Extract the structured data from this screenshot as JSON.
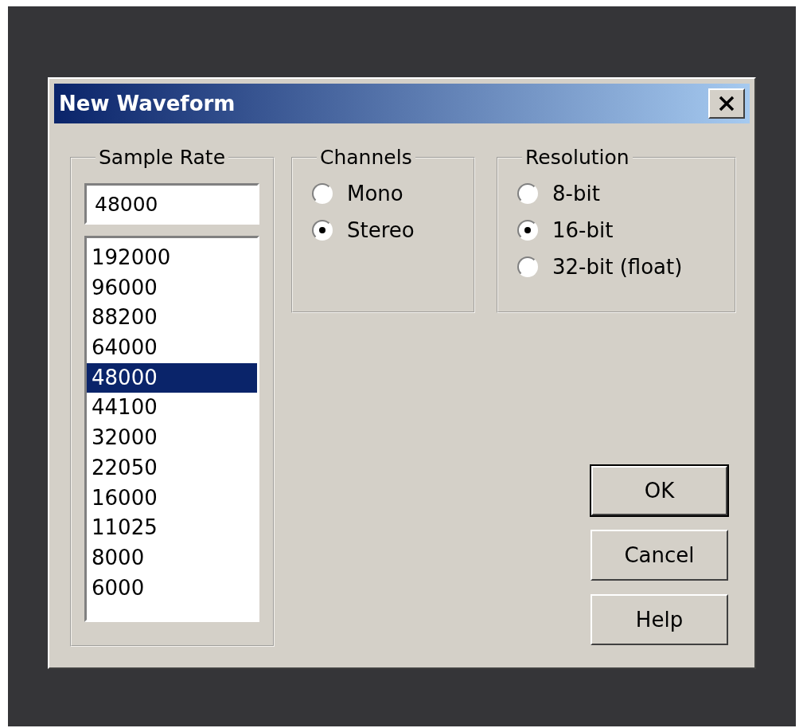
{
  "window": {
    "title": "New Waveform"
  },
  "sample_rate": {
    "label": "Sample Rate",
    "value": "48000",
    "options": [
      {
        "text": "192000",
        "selected": false
      },
      {
        "text": "96000",
        "selected": false
      },
      {
        "text": "88200",
        "selected": false
      },
      {
        "text": "64000",
        "selected": false
      },
      {
        "text": "48000",
        "selected": true
      },
      {
        "text": "44100",
        "selected": false
      },
      {
        "text": "32000",
        "selected": false
      },
      {
        "text": "22050",
        "selected": false
      },
      {
        "text": "16000",
        "selected": false
      },
      {
        "text": "11025",
        "selected": false
      },
      {
        "text": "8000",
        "selected": false
      },
      {
        "text": "6000",
        "selected": false
      }
    ]
  },
  "channels": {
    "label": "Channels",
    "options": [
      {
        "label": "Mono",
        "selected": false
      },
      {
        "label": "Stereo",
        "selected": true
      }
    ]
  },
  "resolution": {
    "label": "Resolution",
    "options": [
      {
        "label": "8-bit",
        "selected": false
      },
      {
        "label": "16-bit",
        "selected": true
      },
      {
        "label": "32-bit (float)",
        "selected": false
      }
    ]
  },
  "buttons": [
    {
      "label": "OK",
      "default": true
    },
    {
      "label": "Cancel",
      "default": false
    },
    {
      "label": "Help",
      "default": false
    }
  ]
}
